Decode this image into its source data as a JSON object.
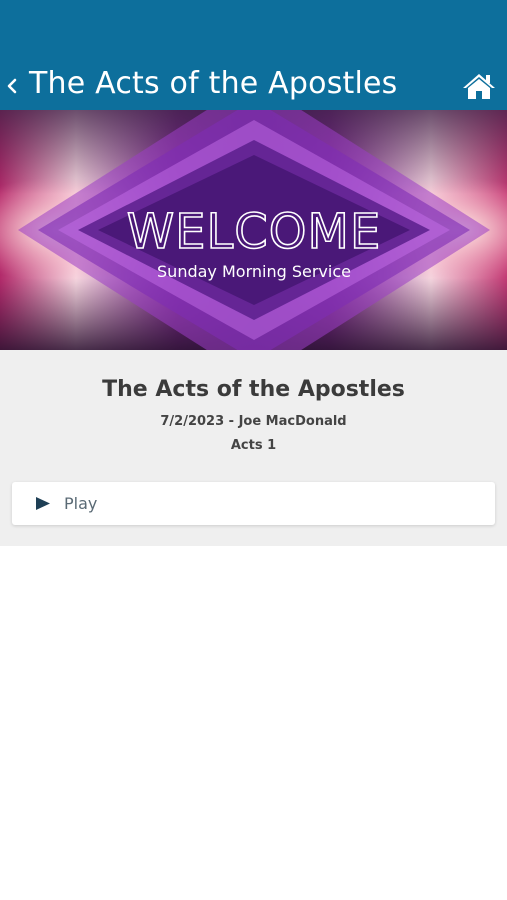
{
  "header": {
    "title": "The Acts of the Apostles",
    "back_icon": "chevron-left-icon",
    "home_icon": "home-icon",
    "bg_color": "#0d6f9c"
  },
  "banner": {
    "headline": "WELCOME",
    "subline": "Sunday Morning Service"
  },
  "sermon": {
    "title": "The Acts of the Apostles",
    "meta": "7/2/2023 - Joe MacDonald",
    "passage": "Acts 1"
  },
  "actions": {
    "play_label": "Play",
    "play_icon": "play-icon",
    "play_icon_color": "#1e3f55"
  }
}
